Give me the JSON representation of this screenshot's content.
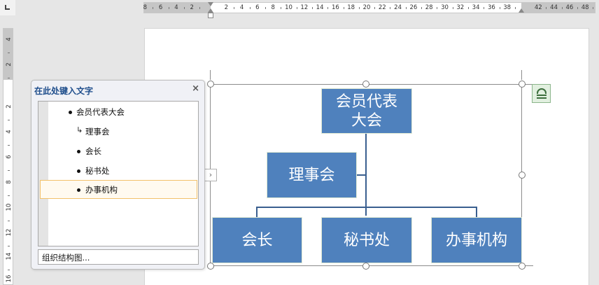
{
  "ruler": {
    "horizontal_left_labels": [
      "8",
      "6",
      "4",
      "2"
    ],
    "horizontal_labels": [
      "2",
      "4",
      "6",
      "8",
      "10",
      "12",
      "14",
      "16",
      "18",
      "20",
      "22",
      "24",
      "26",
      "28",
      "30",
      "32",
      "34",
      "36",
      "38"
    ],
    "horizontal_right_labels": [
      "42",
      "44",
      "46",
      "48"
    ],
    "vertical_labels": [
      "4",
      "2",
      "2",
      "4",
      "6",
      "8",
      "10",
      "12",
      "14",
      "16"
    ]
  },
  "text_pane": {
    "title": "在此处键入文字",
    "close_glyph": "×",
    "items": [
      {
        "label": "会员代表大会",
        "level": 1,
        "marker": "bullet"
      },
      {
        "label": "理事会",
        "level": 2,
        "marker": "assistant-arrow"
      },
      {
        "label": "会长",
        "level": 2,
        "marker": "bullet"
      },
      {
        "label": "秘书处",
        "level": 2,
        "marker": "bullet"
      },
      {
        "label": "办事机构",
        "level": 2,
        "marker": "bullet",
        "selected": true
      }
    ],
    "footer_link": "组织结构图..."
  },
  "expand_glyph": "›",
  "smartart": {
    "fill_color": "#4f81bd",
    "connector_color": "#3a5f8f",
    "nodes": {
      "top": "会员代表\n大会",
      "assistant": "理事会",
      "child1": "会长",
      "child2": "秘书处",
      "child3": "办事机构"
    }
  }
}
